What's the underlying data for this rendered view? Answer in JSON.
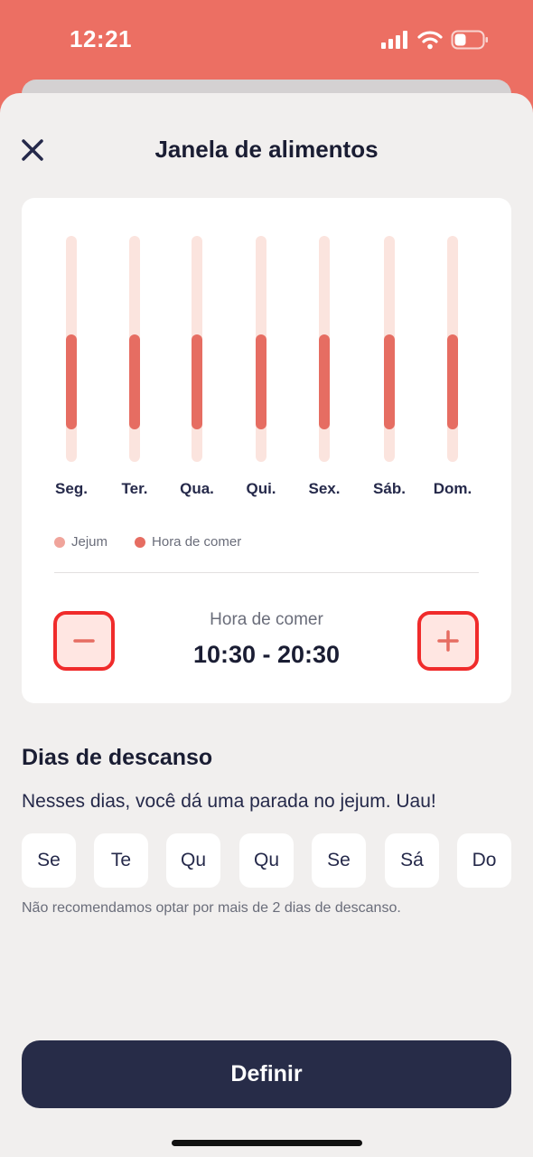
{
  "status_bar": {
    "time": "12:21"
  },
  "header": {
    "title": "Janela de alimentos"
  },
  "chart_data": {
    "type": "bar",
    "categories": [
      "Seg.",
      "Ter.",
      "Qua.",
      "Qui.",
      "Sex.",
      "Sáb.",
      "Dom."
    ],
    "eating_window": [
      "10:30",
      "20:30"
    ],
    "legend": [
      {
        "label": "Jejum",
        "color": "#f0a49b"
      },
      {
        "label": "Hora de comer",
        "color": "#e66d62"
      }
    ]
  },
  "eating": {
    "label": "Hora de comer",
    "value": "10:30 - 20:30"
  },
  "rest_days": {
    "title": "Dias de descanso",
    "subtitle": "Nesses dias, você dá uma parada no jejum. Uau!",
    "days": [
      "Se",
      "Te",
      "Qu",
      "Qu",
      "Se",
      "Sá",
      "Do"
    ],
    "note": "Não recomendamos optar por mais de 2 dias de descanso."
  },
  "footer": {
    "button_label": "Definir"
  },
  "colors": {
    "brand": "#ec6f63",
    "accent": "#e66d62",
    "dark": "#272c48",
    "highlight": "#f02b2b"
  }
}
